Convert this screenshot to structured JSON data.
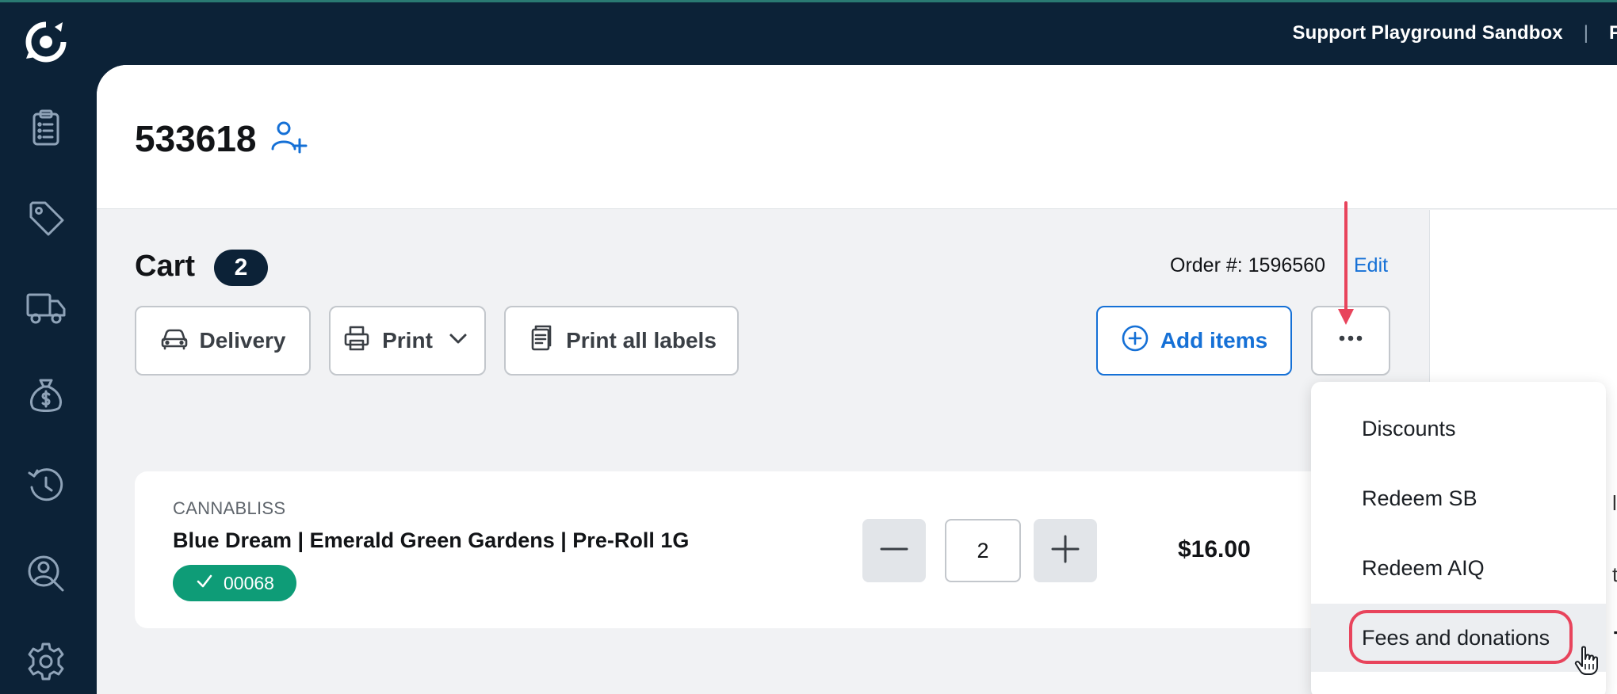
{
  "topbar": {
    "store_name": "Support Playground Sandbox",
    "separator": "|",
    "cut_text": "F"
  },
  "sidebar": {
    "items": [
      {
        "icon": "clipboard-icon"
      },
      {
        "icon": "tag-icon"
      },
      {
        "icon": "truck-icon"
      },
      {
        "icon": "money-bag-icon"
      },
      {
        "icon": "history-icon"
      },
      {
        "icon": "customer-search-icon"
      },
      {
        "icon": "gear-icon"
      }
    ]
  },
  "header": {
    "customer_id": "533618"
  },
  "cart": {
    "title": "Cart",
    "count": "2",
    "order_label": "Order #: 1596560",
    "edit_label": "Edit"
  },
  "toolbar": {
    "delivery_label": "Delivery",
    "print_label": "Print",
    "print_labels_label": "Print all labels",
    "add_items_label": "Add items"
  },
  "item": {
    "brand": "CANNABLISS",
    "name": "Blue Dream | Emerald Green Gardens | Pre-Roll 1G",
    "batch": "00068",
    "quantity": "2",
    "price": "$16.00"
  },
  "menu": {
    "items": [
      "Discounts",
      "Redeem SB",
      "Redeem AIQ",
      "Fees and donations"
    ],
    "hovered_index": 3
  },
  "right_panel": {
    "cut1": "lo",
    "cut2": "ti",
    "cut3": "T"
  },
  "colors": {
    "sidebar": "#0c2237",
    "accent_blue": "#1570d6",
    "batch_green": "#0e9c77",
    "annotation_red": "#e8445c"
  }
}
